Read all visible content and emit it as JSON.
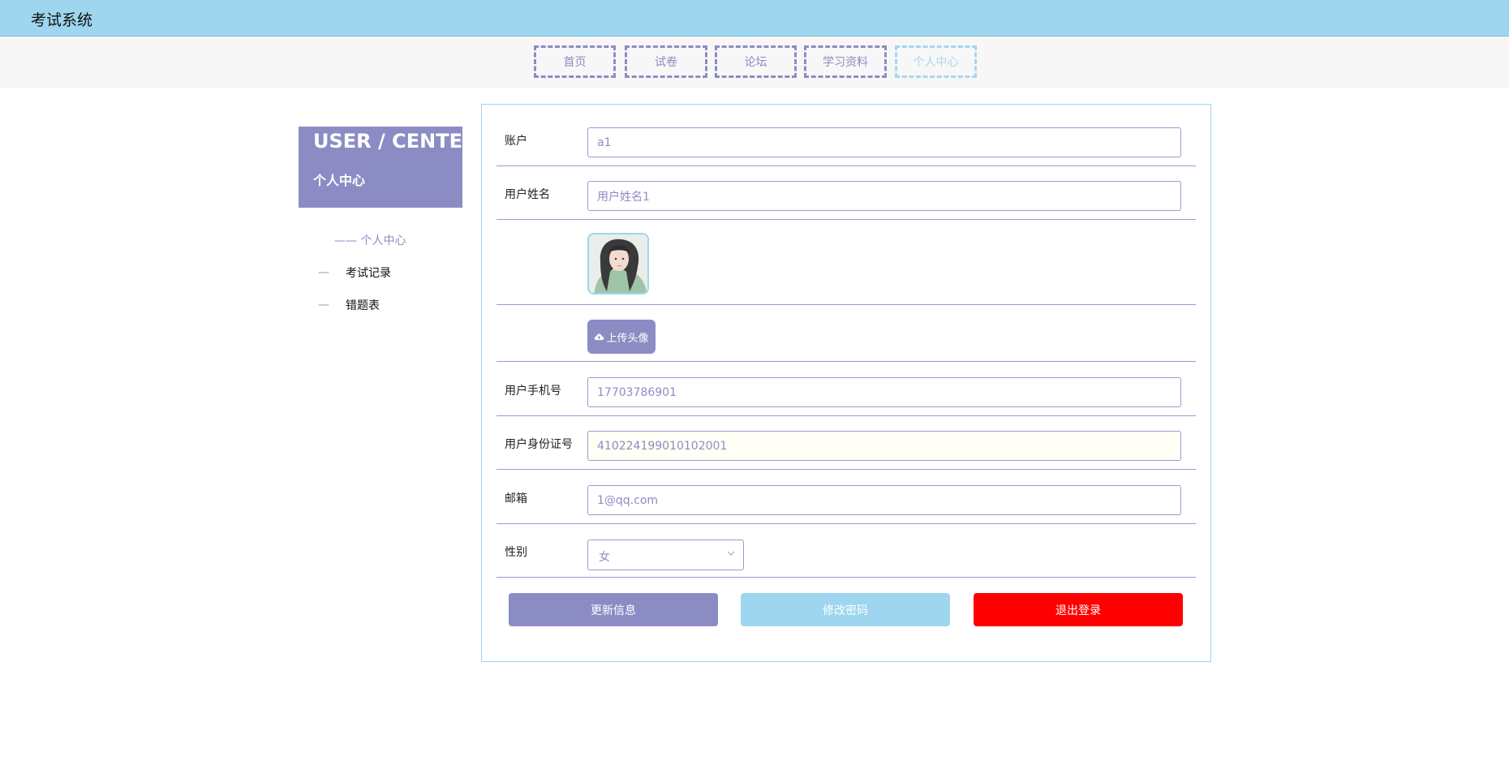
{
  "app": {
    "title": "考试系统"
  },
  "nav": {
    "tabs": [
      {
        "label": "首页"
      },
      {
        "label": "试卷"
      },
      {
        "label": "论坛"
      },
      {
        "label": "学习资料"
      },
      {
        "label": "个人中心",
        "active": true
      }
    ]
  },
  "sidebar": {
    "title_en": "USER / CENTER",
    "title_cn": "个人中心",
    "items": [
      {
        "label": "—— 个人中心",
        "active": true
      },
      {
        "label": "考试记录"
      },
      {
        "label": "错题表"
      }
    ],
    "item_dash": "—"
  },
  "form": {
    "account": {
      "label": "账户",
      "value": "a1"
    },
    "name": {
      "label": "用户姓名",
      "value": "用户姓名1"
    },
    "avatar": {
      "icon": "user-avatar-image"
    },
    "upload": {
      "label": "上传头像",
      "icon": "cloud-upload-icon"
    },
    "phone": {
      "label": "用户手机号",
      "value": "17703786901"
    },
    "id_card": {
      "label": "用户身份证号",
      "value": "410224199010102001"
    },
    "email": {
      "label": "邮箱",
      "value": "1@qq.com"
    },
    "gender": {
      "label": "性别",
      "value": "女",
      "icon": "chevron-down-icon"
    }
  },
  "actions": {
    "update": {
      "label": "更新信息",
      "color": "#8c8cc4"
    },
    "password": {
      "label": "修改密码",
      "color": "#9dd6ee"
    },
    "logout": {
      "label": "退出登录",
      "color": "#ff0000"
    }
  },
  "colors": {
    "accent": "#8c8cc4",
    "header": "#9dd6ee",
    "danger": "#ff0000"
  }
}
